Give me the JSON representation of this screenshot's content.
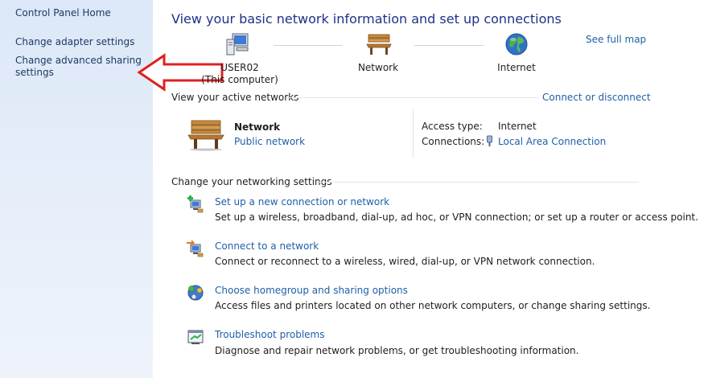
{
  "sidebar": {
    "home_link": "Control Panel Home",
    "adapter_link": "Change adapter settings",
    "sharing_link_line1": "Change advanced sharing",
    "sharing_link_line2": "settings"
  },
  "header": {
    "title": "View your basic network information and set up connections",
    "see_full_map": "See full map"
  },
  "network_map": {
    "computer_name": "USER02",
    "computer_sub": "(This computer)",
    "network_label": "Network",
    "internet_label": "Internet"
  },
  "active_networks": {
    "section_title": "View your active networks",
    "connect_link": "Connect or disconnect",
    "network_name": "Network",
    "network_type": "Public network",
    "access_type_label": "Access type:",
    "access_type_value": "Internet",
    "connections_label": "Connections:",
    "connections_value": "Local Area Connection"
  },
  "settings": {
    "section_title": "Change your networking settings",
    "tasks": [
      {
        "title": "Set up a new connection or network",
        "desc": "Set up a wireless, broadband, dial-up, ad hoc, or VPN connection; or set up a router or access point.",
        "icon": "new-connection-icon"
      },
      {
        "title": "Connect to a network",
        "desc": "Connect or reconnect to a wireless, wired, dial-up, or VPN network connection.",
        "icon": "connect-network-icon"
      },
      {
        "title": "Choose homegroup and sharing options",
        "desc": "Access files and printers located on other network computers, or change sharing settings.",
        "icon": "homegroup-icon"
      },
      {
        "title": "Troubleshoot problems",
        "desc": "Diagnose and repair network problems, or get troubleshooting information.",
        "icon": "troubleshoot-icon"
      }
    ]
  }
}
